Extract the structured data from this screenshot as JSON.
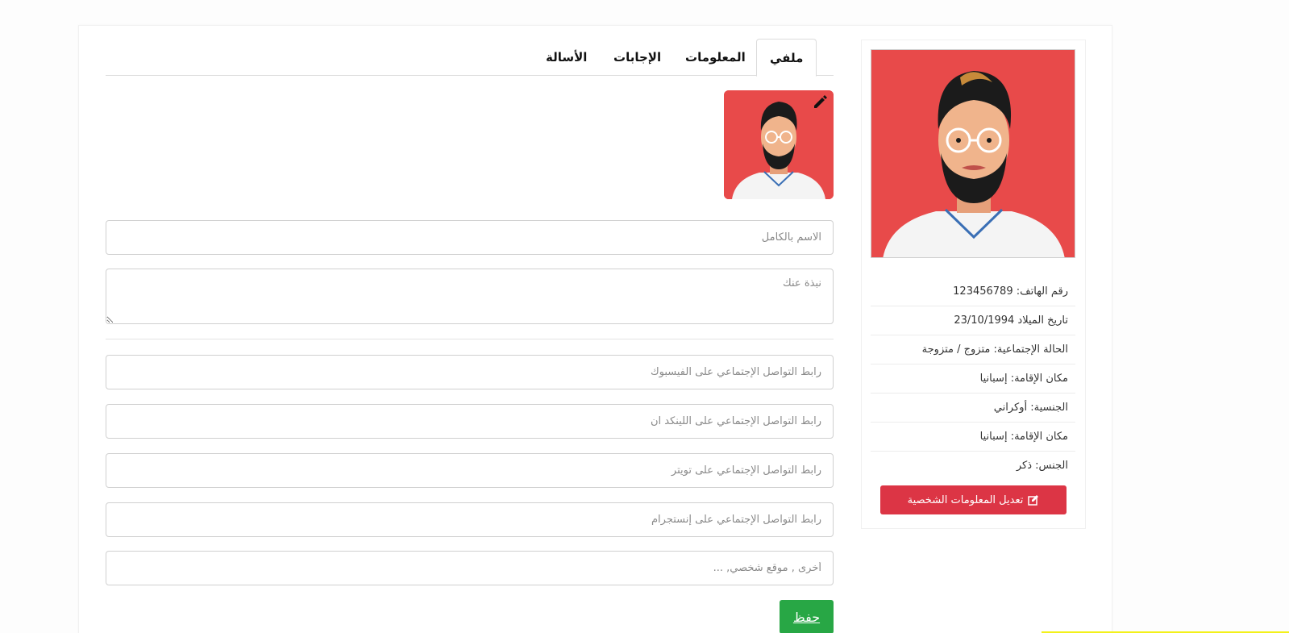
{
  "tabs": [
    {
      "label": "ملفي",
      "active": true
    },
    {
      "label": "المعلومات",
      "active": false
    },
    {
      "label": "الإجابات",
      "active": false
    },
    {
      "label": "الأسالة",
      "active": false
    }
  ],
  "form": {
    "full_name_placeholder": "الاسم بالكامل",
    "bio_placeholder": "نبذة عنك",
    "facebook_placeholder": "رابط التواصل الإجتماعي على الفيسبوك",
    "linkedin_placeholder": "رابط التواصل الإجتماعي على اللينكد ان",
    "twitter_placeholder": "رابط التواصل الإجتماعي على تويتر",
    "instagram_placeholder": "رابط التواصل الإجتماعي على إنستجرام",
    "other_placeholder": "أخرى , موقع شخصي, ...",
    "save_label": "حفظ"
  },
  "profile": {
    "info": [
      "رقم الهاتف: 123456789",
      "تاريخ الميلاد 23/10/1994",
      "الحالة الإجتماعية: متزوج / متزوجة",
      "مكان الإقامة: إسبانيا",
      "الجنسية: أوكراني",
      "مكان الإقامة: إسبانيا",
      "الجنس: ذكر"
    ],
    "edit_label": "تعديل المعلومات الشخصية"
  },
  "colors": {
    "avatar_bg": "#e84a4a",
    "save": "#28a745",
    "edit": "#dc3545",
    "accent_line": "#f3f11a"
  },
  "icons": {
    "avatar_edit": "pencil-icon",
    "edit_profile": "edit-square-icon"
  }
}
